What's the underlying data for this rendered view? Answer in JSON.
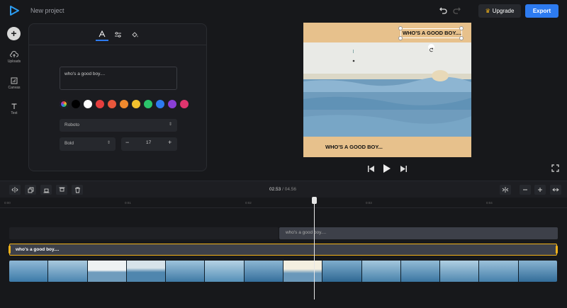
{
  "header": {
    "project_title": "New project",
    "upgrade_label": "Upgrade",
    "export_label": "Export"
  },
  "sidebar": {
    "items": [
      {
        "label": "Uploads",
        "icon": "upload-icon"
      },
      {
        "label": "Canvas",
        "icon": "canvas-icon"
      },
      {
        "label": "Text",
        "icon": "text-icon"
      }
    ]
  },
  "text_panel": {
    "tabs": [
      "text-tab-icon",
      "settings-tab-icon",
      "fill-tab-icon"
    ],
    "text_value": "who's a good boy....",
    "colors": [
      "#000000",
      "#ffffff",
      "#e53e3e",
      "#e8573c",
      "#f08a2e",
      "#f2c12e",
      "#2bc46a",
      "#2d7bf0",
      "#8a3fd6",
      "#e0356e"
    ],
    "font": "Roboto",
    "weight": "Bold",
    "size": "17"
  },
  "preview": {
    "top_caption": "WHO'S A GOOD BOY....",
    "bottom_caption": "WHO'S A GOOD BOY..."
  },
  "timeline": {
    "current_time": "02.53",
    "separator": "/",
    "total_time": "04.56",
    "ticks": [
      "0:00",
      "0:01",
      "0:02",
      "0:03",
      "0:04"
    ],
    "clip_text_1": "who's a good boy....",
    "clip_text_2": "who's a good boy...."
  }
}
